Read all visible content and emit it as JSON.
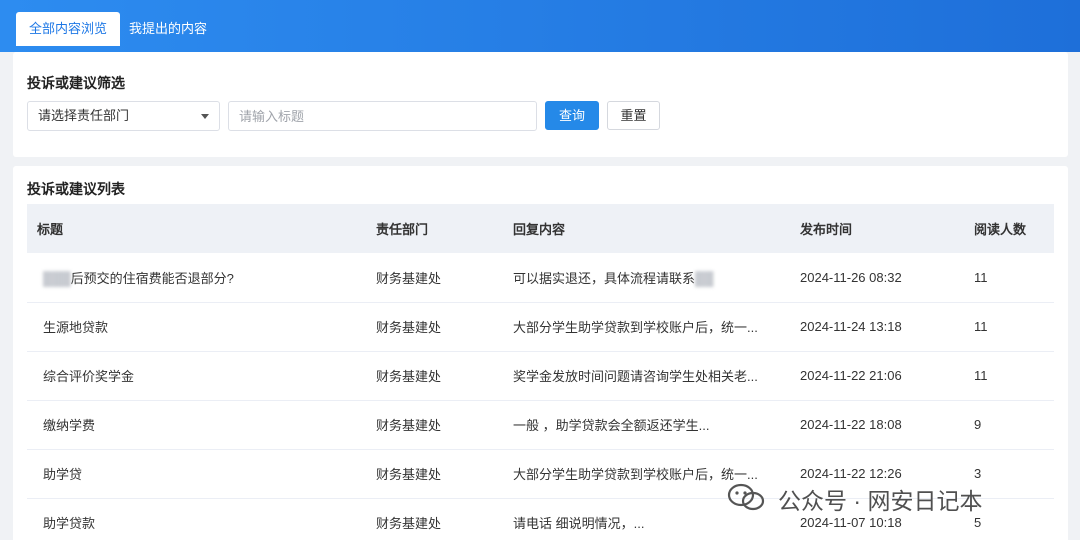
{
  "tabs": [
    {
      "label": "全部内容浏览",
      "active": true
    },
    {
      "label": "我提出的内容",
      "active": false
    }
  ],
  "filter": {
    "title": "投诉或建议筛选",
    "department_select": "请选择责任部门",
    "title_input_placeholder": "请输入标题",
    "query_button": "查询",
    "reset_button": "重置"
  },
  "list": {
    "title": "投诉或建议列表",
    "columns": [
      "标题",
      "责任部门",
      "回复内容",
      "发布时间",
      "阅读人数"
    ],
    "rows": [
      {
        "title": "后预交的住宿费能否退部分?",
        "dept": "财务基建处",
        "reply": "可以据实退还，具体流程请联系",
        "time": "2024-11-26 08:32",
        "reads": "11"
      },
      {
        "title": "生源地贷款",
        "dept": "财务基建处",
        "reply": "大部分学生助学贷款到学校账户后，统一...",
        "time": "2024-11-24 13:18",
        "reads": "11"
      },
      {
        "title": "综合评价奖学金",
        "dept": "财务基建处",
        "reply": "奖学金发放时间问题请咨询学生处相关老...",
        "time": "2024-11-22 21:06",
        "reads": "11"
      },
      {
        "title": "缴纳学费",
        "dept": "财务基建处",
        "reply": "一般 ，助学贷款会全额返还学生...",
        "time": "2024-11-22 18:08",
        "reads": "9"
      },
      {
        "title": "助学贷",
        "dept": "财务基建处",
        "reply": "大部分学生助学贷款到学校账户后，统一...",
        "time": "2024-11-22 12:26",
        "reads": "3"
      },
      {
        "title": "助学贷款",
        "dept": "财务基建处",
        "reply": "请电话 细说明情况，...",
        "time": "2024-11-07 10:18",
        "reads": "5"
      }
    ]
  },
  "watermark": {
    "text": "公众号 · 网安日记本",
    "icon": "wechat-icon"
  },
  "colors": {
    "accent": "#2589e8",
    "header_bg": "#1e6fd9",
    "table_head_bg": "#eef1f6"
  }
}
